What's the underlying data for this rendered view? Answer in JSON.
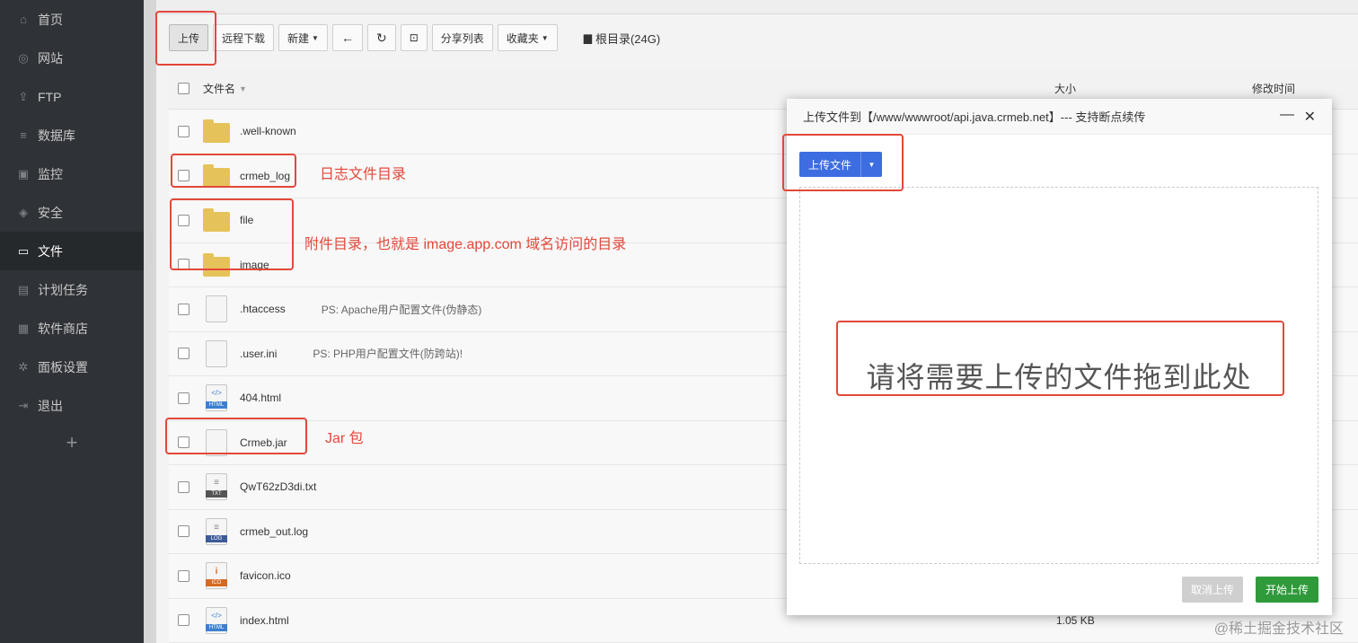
{
  "sidebar": {
    "items": [
      {
        "label": "首页",
        "icon": "home-icon",
        "glyph": "⌂"
      },
      {
        "label": "网站",
        "icon": "globe-icon",
        "glyph": "◎"
      },
      {
        "label": "FTP",
        "icon": "ftp-icon",
        "glyph": "⇪"
      },
      {
        "label": "数据库",
        "icon": "database-icon",
        "glyph": "≡"
      },
      {
        "label": "监控",
        "icon": "monitor-icon",
        "glyph": "▣"
      },
      {
        "label": "安全",
        "icon": "shield-icon",
        "glyph": "◈"
      },
      {
        "label": "文件",
        "icon": "folder-icon",
        "glyph": "▭"
      },
      {
        "label": "计划任务",
        "icon": "calendar-icon",
        "glyph": "▤"
      },
      {
        "label": "软件商店",
        "icon": "apps-icon",
        "glyph": "▦"
      },
      {
        "label": "面板设置",
        "icon": "gear-icon",
        "glyph": "✲"
      },
      {
        "label": "退出",
        "icon": "logout-icon",
        "glyph": "⇥"
      }
    ],
    "add_label": "+"
  },
  "toolbar": {
    "upload": "上传",
    "remote_download": "远程下载",
    "new": "新建",
    "share_list": "分享列表",
    "favorites": "收藏夹",
    "disk": "根目录(24G)"
  },
  "table": {
    "col_name": "文件名",
    "col_size": "大小",
    "col_time": "修改时间",
    "rows": [
      {
        "name": ".well-known",
        "type": "folder",
        "note": "",
        "size": ""
      },
      {
        "name": "crmeb_log",
        "type": "folder",
        "note": "",
        "size": ""
      },
      {
        "name": "file",
        "type": "folder",
        "note": "",
        "size": ""
      },
      {
        "name": "image",
        "type": "folder",
        "note": "",
        "size": ""
      },
      {
        "name": ".htaccess",
        "type": "file",
        "note": "PS: Apache用户配置文件(伪静态)",
        "size": ""
      },
      {
        "name": ".user.ini",
        "type": "file",
        "note": "PS: PHP用户配置文件(防跨站)!",
        "size": ""
      },
      {
        "name": "404.html",
        "type": "html",
        "note": "",
        "size": ""
      },
      {
        "name": "Crmeb.jar",
        "type": "file",
        "note": "",
        "size": ""
      },
      {
        "name": "QwT62zD3di.txt",
        "type": "txt",
        "note": "",
        "size": ""
      },
      {
        "name": "crmeb_out.log",
        "type": "log",
        "note": "",
        "size": ""
      },
      {
        "name": "favicon.ico",
        "type": "ico",
        "note": "",
        "size": ""
      },
      {
        "name": "index.html",
        "type": "html",
        "note": "",
        "size": "1.05 KB"
      }
    ]
  },
  "annotations": {
    "log_dir": "日志文件目录",
    "attach_dir": "附件目录，也就是 image.app.com 域名访问的目录",
    "jar": "Jar 包"
  },
  "modal": {
    "title": "上传文件到【/www/wwwroot/api.java.crmeb.net】--- 支持断点续传",
    "upload_file": "上传文件",
    "drop_text": "请将需要上传的文件拖到此处",
    "cancel": "取消上传",
    "start": "开始上传",
    "minimize": "—",
    "close": "✕"
  },
  "file_tags": {
    "html": "HTML",
    "txt": "TXT",
    "log": "LOG",
    "ico": "ICO"
  },
  "colors": {
    "accent": "#3d6de0",
    "start": "#2f9a3a",
    "annotation": "#e2483a"
  },
  "watermark": "@稀土掘金技术社区"
}
